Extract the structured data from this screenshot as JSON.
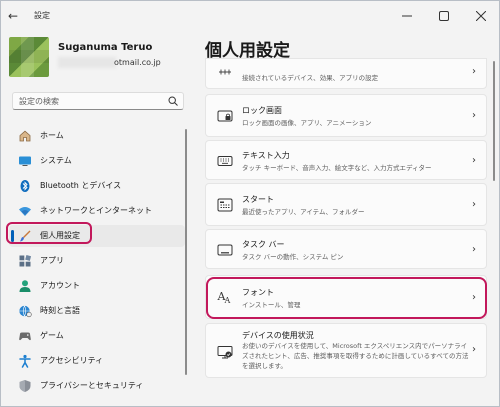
{
  "window": {
    "title": "設定"
  },
  "profile": {
    "name": "Suganuma Teruo",
    "email": "otmail.co.jp"
  },
  "search": {
    "placeholder": "設定の検索"
  },
  "nav": {
    "items": [
      {
        "label": "ホーム",
        "icon": "home-icon"
      },
      {
        "label": "システム",
        "icon": "system-icon"
      },
      {
        "label": "Bluetooth とデバイス",
        "icon": "bluetooth-icon"
      },
      {
        "label": "ネットワークとインターネット",
        "icon": "wifi-icon"
      },
      {
        "label": "個人用設定",
        "icon": "brush-icon",
        "selected": true
      },
      {
        "label": "アプリ",
        "icon": "apps-icon"
      },
      {
        "label": "アカウント",
        "icon": "account-icon"
      },
      {
        "label": "時刻と言語",
        "icon": "time-language-icon"
      },
      {
        "label": "ゲーム",
        "icon": "game-icon"
      },
      {
        "label": "アクセシビリティ",
        "icon": "accessibility-icon"
      },
      {
        "label": "プライバシーとセキュリティ",
        "icon": "shield-icon"
      }
    ]
  },
  "page": {
    "title": "個人用設定"
  },
  "cards": [
    {
      "title": "",
      "desc": "接続されているデバイス、効果、アプリの設定",
      "icon": "dynamic-lighting-icon"
    },
    {
      "title": "ロック画面",
      "desc": "ロック画面の画像、アプリ、アニメーション",
      "icon": "lock-screen-icon"
    },
    {
      "title": "テキスト入力",
      "desc": "タッチ キーボード、音声入力、絵文字など、入力方式エディター",
      "icon": "keyboard-icon"
    },
    {
      "title": "スタート",
      "desc": "最近使ったアプリ、アイテム、フォルダー",
      "icon": "start-icon"
    },
    {
      "title": "タスク バー",
      "desc": "タスク バーの動作、システム ピン",
      "icon": "taskbar-icon"
    },
    {
      "title": "フォント",
      "desc": "インストール、管理",
      "icon": "font-icon"
    },
    {
      "title": "デバイスの使用状況",
      "desc": "お使いのデバイスを使用して、Microsoft エクスペリエンス内でパーソナライズされたヒント、広告、推奨事項を取得するために計画しているすべての方法を選択します。",
      "icon": "device-usage-icon"
    }
  ],
  "colors": {
    "accent": "#005fb8",
    "highlight": "#c2185b"
  }
}
